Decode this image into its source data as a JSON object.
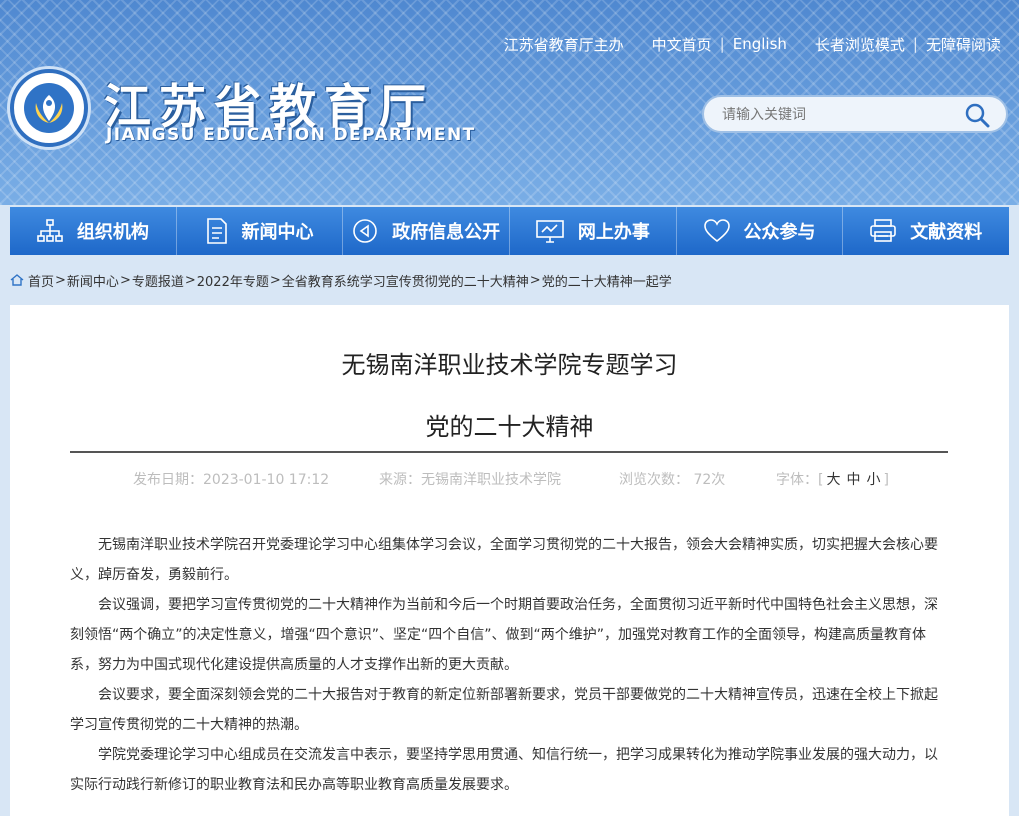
{
  "header": {
    "top_links": [
      "江苏省教育厅主办",
      "中文首页",
      "English",
      "长者浏览模式",
      "无障碍阅读"
    ],
    "title": "江苏省教育厅",
    "subtitle": "JIANGSU EDUCATION DEPARTMENT",
    "search_placeholder": "请输入关键词"
  },
  "nav": [
    {
      "label": "组织机构",
      "icon": "org-chart-icon"
    },
    {
      "label": "新闻中心",
      "icon": "document-icon"
    },
    {
      "label": "政府信息公开",
      "icon": "circle-play-icon"
    },
    {
      "label": "网上办事",
      "icon": "monitor-icon"
    },
    {
      "label": "公众参与",
      "icon": "heart-icon"
    },
    {
      "label": "文献资料",
      "icon": "printer-icon"
    }
  ],
  "breadcrumb": [
    "首页",
    "新闻中心",
    "专题报道",
    "2022年专题",
    "全省教育系统学习宣传贯彻党的二十大精神",
    "党的二十大精神一起学"
  ],
  "article": {
    "title_line1": "无锡南洋职业技术学院专题学习",
    "title_line2": "党的二十大精神",
    "publish_date": "发布日期：2023-01-10 17:12",
    "source": "来源：无锡南洋职业技术学院",
    "views": "浏览次数： 72次",
    "font_label": "字体：[",
    "font_large": "大",
    "font_medium": "中",
    "font_small": "小",
    "font_close": "]",
    "paragraphs": [
      "无锡南洋职业技术学院召开党委理论学习中心组集体学习会议，全面学习贯彻党的二十大报告，领会大会精神实质，切实把握大会核心要义，踔厉奋发，勇毅前行。",
      "会议强调，要把学习宣传贯彻党的二十大精神作为当前和今后一个时期首要政治任务，全面贯彻习近平新时代中国特色社会主义思想，深刻领悟“两个确立”的决定性意义，增强“四个意识”、坚定“四个自信”、做到“两个维护”，加强党对教育工作的全面领导，构建高质量教育体系，努力为中国式现代化建设提供高质量的人才支撑作出新的更大贡献。",
      "会议要求，要全面深刻领会党的二十大报告对于教育的新定位新部署新要求，党员干部要做党的二十大精神宣传员，迅速在全校上下掀起学习宣传贯彻党的二十大精神的热潮。",
      "学院党委理论学习中心组成员在交流发言中表示，要坚持学思用贯通、知信行统一，把学习成果转化为推动学院事业发展的强大动力，以实际行动践行新修订的职业教育法和民办高等职业教育高质量发展要求。"
    ]
  }
}
